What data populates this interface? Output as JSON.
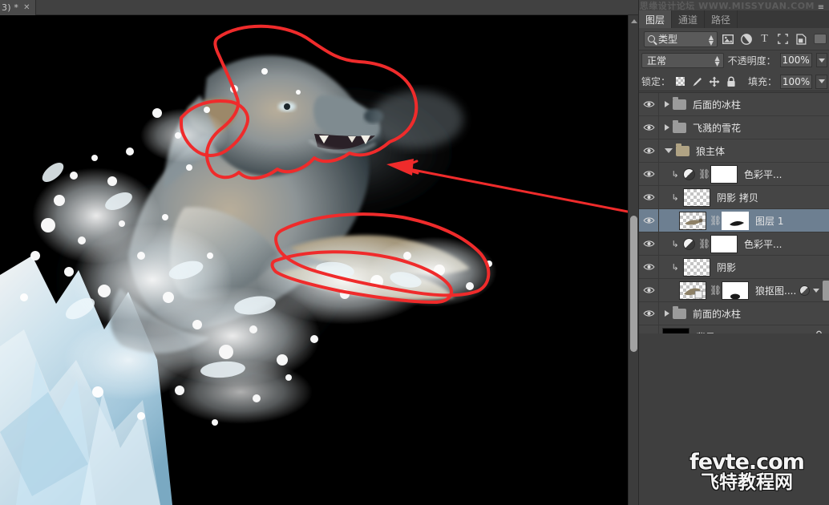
{
  "document": {
    "tab_title": "3) *",
    "close_label": "✕"
  },
  "panel": {
    "watermark_top": "思缘设计论坛 WWW.MISSYUAN.COM",
    "watermark_bottom_line1": "fevte.com",
    "watermark_bottom_line2": "飞特教程网",
    "menu_icon": "≡",
    "tabs": [
      {
        "label": "图层",
        "active": true
      },
      {
        "label": "通道",
        "active": false
      },
      {
        "label": "路径",
        "active": false
      }
    ],
    "filter": {
      "kind_label": "类型",
      "search_icon": "search-icon",
      "icons": [
        {
          "name": "pixel-layer-filter-icon",
          "glyph": "▣"
        },
        {
          "name": "adjustment-layer-filter-icon",
          "glyph": "◑"
        },
        {
          "name": "type-layer-filter-icon",
          "glyph": "T"
        },
        {
          "name": "shape-layer-filter-icon",
          "glyph": "⬚"
        },
        {
          "name": "smart-object-filter-icon",
          "glyph": "❐"
        }
      ]
    },
    "blend": {
      "mode": "正常",
      "opacity_label": "不透明度：",
      "opacity_value": "100%"
    },
    "lock": {
      "lock_label": "锁定：",
      "fill_label": "填充：",
      "fill_value": "100%",
      "icons": [
        {
          "name": "lock-transparent-pixels-icon",
          "glyph": ""
        },
        {
          "name": "lock-image-pixels-icon",
          "glyph": "✎"
        },
        {
          "name": "lock-position-icon",
          "glyph": "✛"
        },
        {
          "name": "lock-all-icon",
          "glyph": "🔒"
        }
      ]
    },
    "layers": [
      {
        "name": "后面的冰柱",
        "type": "group",
        "expanded": false,
        "visible": true,
        "selected": false,
        "indent": 0
      },
      {
        "name": "飞溅的雪花",
        "type": "group",
        "expanded": false,
        "visible": true,
        "selected": false,
        "indent": 0
      },
      {
        "name": "狼主体",
        "type": "group",
        "expanded": true,
        "visible": true,
        "selected": false,
        "indent": 0
      },
      {
        "name": "色彩平...",
        "type": "adjustment",
        "clipped": true,
        "has_mask": true,
        "linked": true,
        "visible": true,
        "selected": false,
        "indent": 1
      },
      {
        "name": "阴影 拷贝",
        "type": "pixel",
        "clipped": true,
        "has_mask": false,
        "linked": false,
        "visible": true,
        "selected": false,
        "indent": 1
      },
      {
        "name": "图层 1",
        "type": "pixel",
        "clipped": false,
        "has_mask": true,
        "linked": true,
        "visible": true,
        "selected": true,
        "indent": 1
      },
      {
        "name": "色彩平...",
        "type": "adjustment",
        "clipped": true,
        "has_mask": true,
        "linked": true,
        "visible": true,
        "selected": false,
        "indent": 1
      },
      {
        "name": "阴影",
        "type": "pixel",
        "clipped": true,
        "has_mask": false,
        "linked": false,
        "visible": true,
        "selected": false,
        "indent": 1
      },
      {
        "name": "狼抠图....",
        "type": "pixel",
        "clipped": false,
        "has_mask": true,
        "linked": true,
        "has_fx": true,
        "visible": true,
        "selected": false,
        "indent": 1
      },
      {
        "name": "前面的冰柱",
        "type": "group",
        "expanded": false,
        "visible": true,
        "selected": false,
        "indent": 0
      },
      {
        "name": "背景",
        "type": "background",
        "locked": true,
        "visible": true,
        "selected": false,
        "indent": 0
      }
    ]
  },
  "colors": {
    "panel_bg": "#434343",
    "row_bg": "#454545",
    "selected_row": "#6d7f91",
    "annotation_red": "#ef2b2b",
    "canvas_bg": "#000000",
    "ice_blue": "#bcdcec"
  },
  "canvas": {
    "description": "wolf-leaping-with-ice-and-snow-splash",
    "annotations": [
      {
        "name": "head-and-muzzle-outline",
        "shape": "freeform-loop"
      },
      {
        "name": "ear-outline",
        "shape": "freeform-loop"
      },
      {
        "name": "front-paw-upper-outline",
        "shape": "freeform-loop"
      },
      {
        "name": "front-paw-lower-outline",
        "shape": "freeform-loop"
      },
      {
        "name": "pointer-arrow-to-layer-1",
        "shape": "arrow"
      }
    ],
    "scrollbar": {
      "name": "canvas-vertical-scrollbar"
    }
  }
}
